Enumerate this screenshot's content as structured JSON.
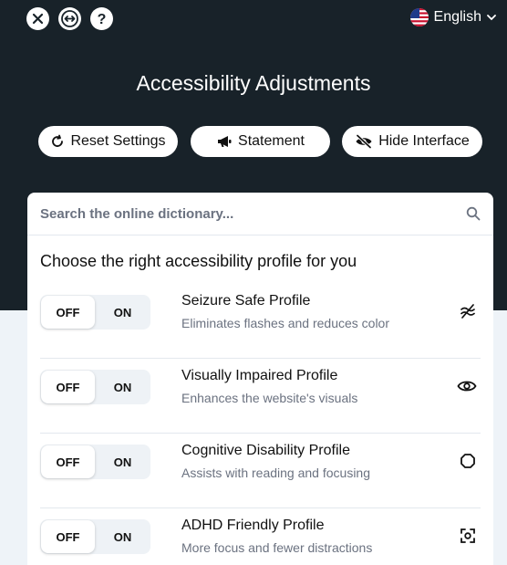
{
  "header": {
    "close_icon": "close-icon",
    "resize_icon": "horizontal-arrows-icon",
    "help_icon": "help-icon",
    "language": "English",
    "title": "Accessibility Adjustments"
  },
  "actions": {
    "reset_label": "Reset Settings",
    "statement_label": "Statement",
    "hide_label": "Hide Interface"
  },
  "search": {
    "placeholder": "Search the online dictionary..."
  },
  "profiles_heading": "Choose the right accessibility profile for you",
  "profiles": [
    {
      "title": "Seizure Safe Profile",
      "description": "Eliminates flashes and reduces color",
      "off": "OFF",
      "on": "ON",
      "icon": "wave-lines-icon"
    },
    {
      "title": "Visually Impaired Profile",
      "description": "Enhances the website's visuals",
      "off": "OFF",
      "on": "ON",
      "icon": "eye-icon"
    },
    {
      "title": "Cognitive Disability Profile",
      "description": "Assists with reading and focusing",
      "off": "OFF",
      "on": "ON",
      "icon": "octagon-icon"
    },
    {
      "title": "ADHD Friendly Profile",
      "description": "More focus and fewer distractions",
      "off": "OFF",
      "on": "ON",
      "icon": "focus-frame-icon"
    }
  ],
  "colors": {
    "header_bg": "#182229",
    "panel_bg": "#eef3f8",
    "card_bg": "#ffffff",
    "muted_text": "#6b7280"
  }
}
